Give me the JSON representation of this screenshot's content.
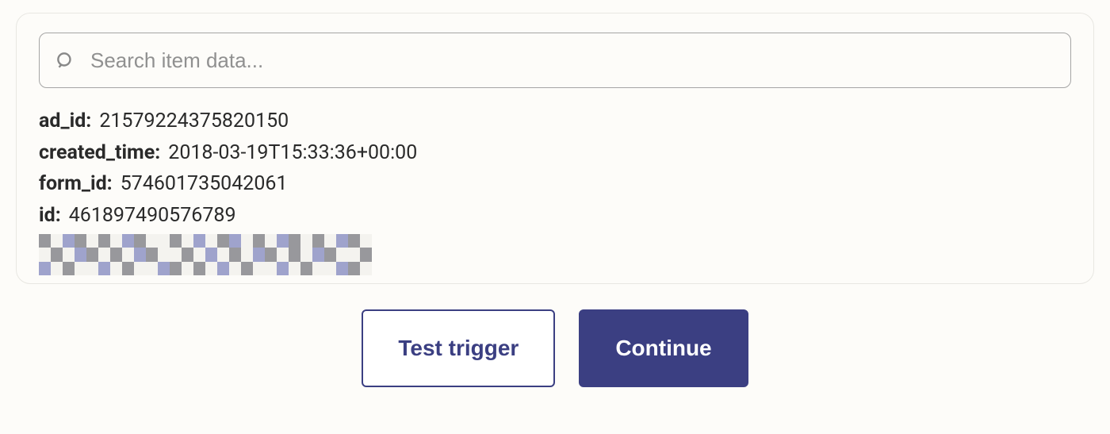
{
  "search": {
    "placeholder": "Search item data..."
  },
  "fields": [
    {
      "key": "ad_id:",
      "value": "21579224375820150"
    },
    {
      "key": "created_time:",
      "value": "2018-03-19T15:33:36+00:00"
    },
    {
      "key": "form_id:",
      "value": "574601735042061"
    },
    {
      "key": "id:",
      "value": "461897490576789"
    }
  ],
  "buttons": {
    "test_trigger": "Test trigger",
    "continue": "Continue"
  }
}
